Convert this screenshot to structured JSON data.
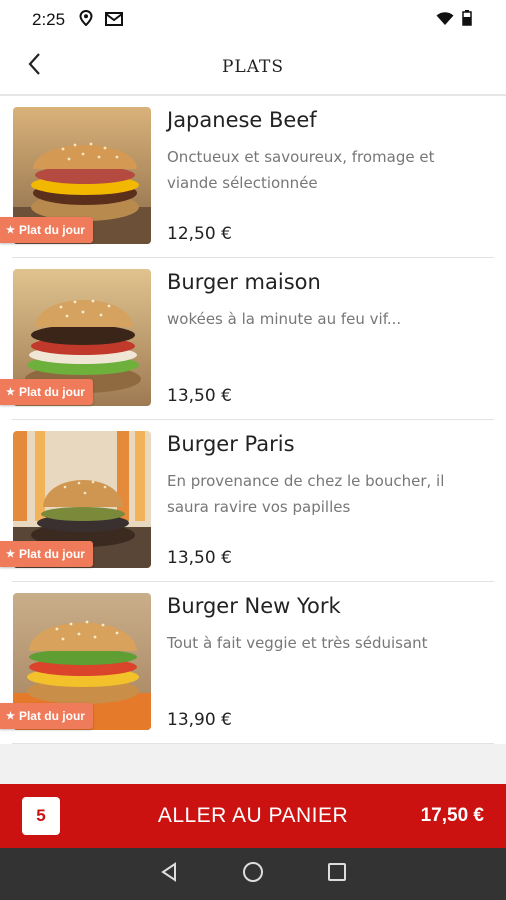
{
  "status": {
    "time": "2:25"
  },
  "header": {
    "title": "PLATS"
  },
  "badge_label": "Plat du jour",
  "items": [
    {
      "name": "Japanese Beef",
      "description": "Onctueux et savoureux, fromage et viande sélectionnée",
      "price": "12,50 €",
      "badge": "Plat du jour"
    },
    {
      "name": "Burger maison",
      "description": "wokées à la minute au feu vif...",
      "price": "13,50 €",
      "badge": "Plat du jour"
    },
    {
      "name": "Burger Paris",
      "description": "En provenance de chez le boucher, il saura ravire vos papilles",
      "price": "13,50 €",
      "badge": "Plat du jour"
    },
    {
      "name": "Burger New York",
      "description": "Tout à fait veggie et très séduisant",
      "price": "13,90 €",
      "badge": "Plat du jour"
    }
  ],
  "cart": {
    "count": "5",
    "label": "ALLER AU PANIER",
    "total": "17,50 €"
  },
  "colors": {
    "accent": "#cc1111",
    "badge": "#f07b5a",
    "navbar": "#333333"
  },
  "icons": {
    "back": "chevron-left-icon",
    "location": "location-pin-icon",
    "mail": "mail-icon",
    "wifi": "wifi-icon",
    "battery": "battery-icon",
    "nav_back": "triangle-back-icon",
    "nav_home": "circle-home-icon",
    "nav_recents": "square-recents-icon"
  }
}
